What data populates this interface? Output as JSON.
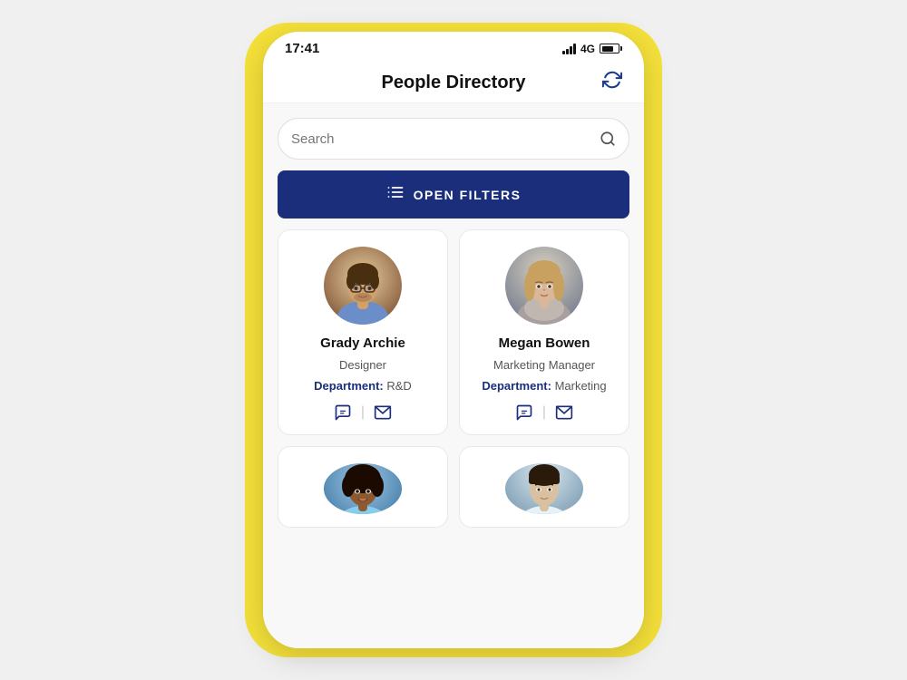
{
  "statusBar": {
    "time": "17:41",
    "network": "4G"
  },
  "header": {
    "title": "People Directory",
    "refreshLabel": "refresh"
  },
  "search": {
    "placeholder": "Search"
  },
  "filters": {
    "buttonLabel": "OPEN FILTERS",
    "iconLabel": "filter-list-icon"
  },
  "people": [
    {
      "id": "grady-archie",
      "name": "Grady Archie",
      "role": "Designer",
      "deptLabel": "Department:",
      "dept": "R&D",
      "avatarColor1": "#b5845a",
      "avatarColor2": "#d4a06a"
    },
    {
      "id": "megan-bowen",
      "name": "Megan Bowen",
      "role": "Marketing Manager",
      "deptLabel": "Department:",
      "dept": "Marketing",
      "avatarColor1": "#c4a882",
      "avatarColor2": "#e0c8a0"
    },
    {
      "id": "person-3",
      "name": "",
      "role": "",
      "deptLabel": "",
      "dept": "",
      "avatarColor1": "#5a3a1a",
      "avatarColor2": "#a07040"
    },
    {
      "id": "person-4",
      "name": "",
      "role": "",
      "deptLabel": "",
      "dept": "",
      "avatarColor1": "#b8a090",
      "avatarColor2": "#d0b898"
    }
  ],
  "actions": {
    "chatLabel": "chat",
    "emailLabel": "email",
    "divider": "|"
  },
  "colors": {
    "accent": "#1a2e7c",
    "filterBg": "#1a2e7c",
    "yellow": "#F5E13A"
  }
}
